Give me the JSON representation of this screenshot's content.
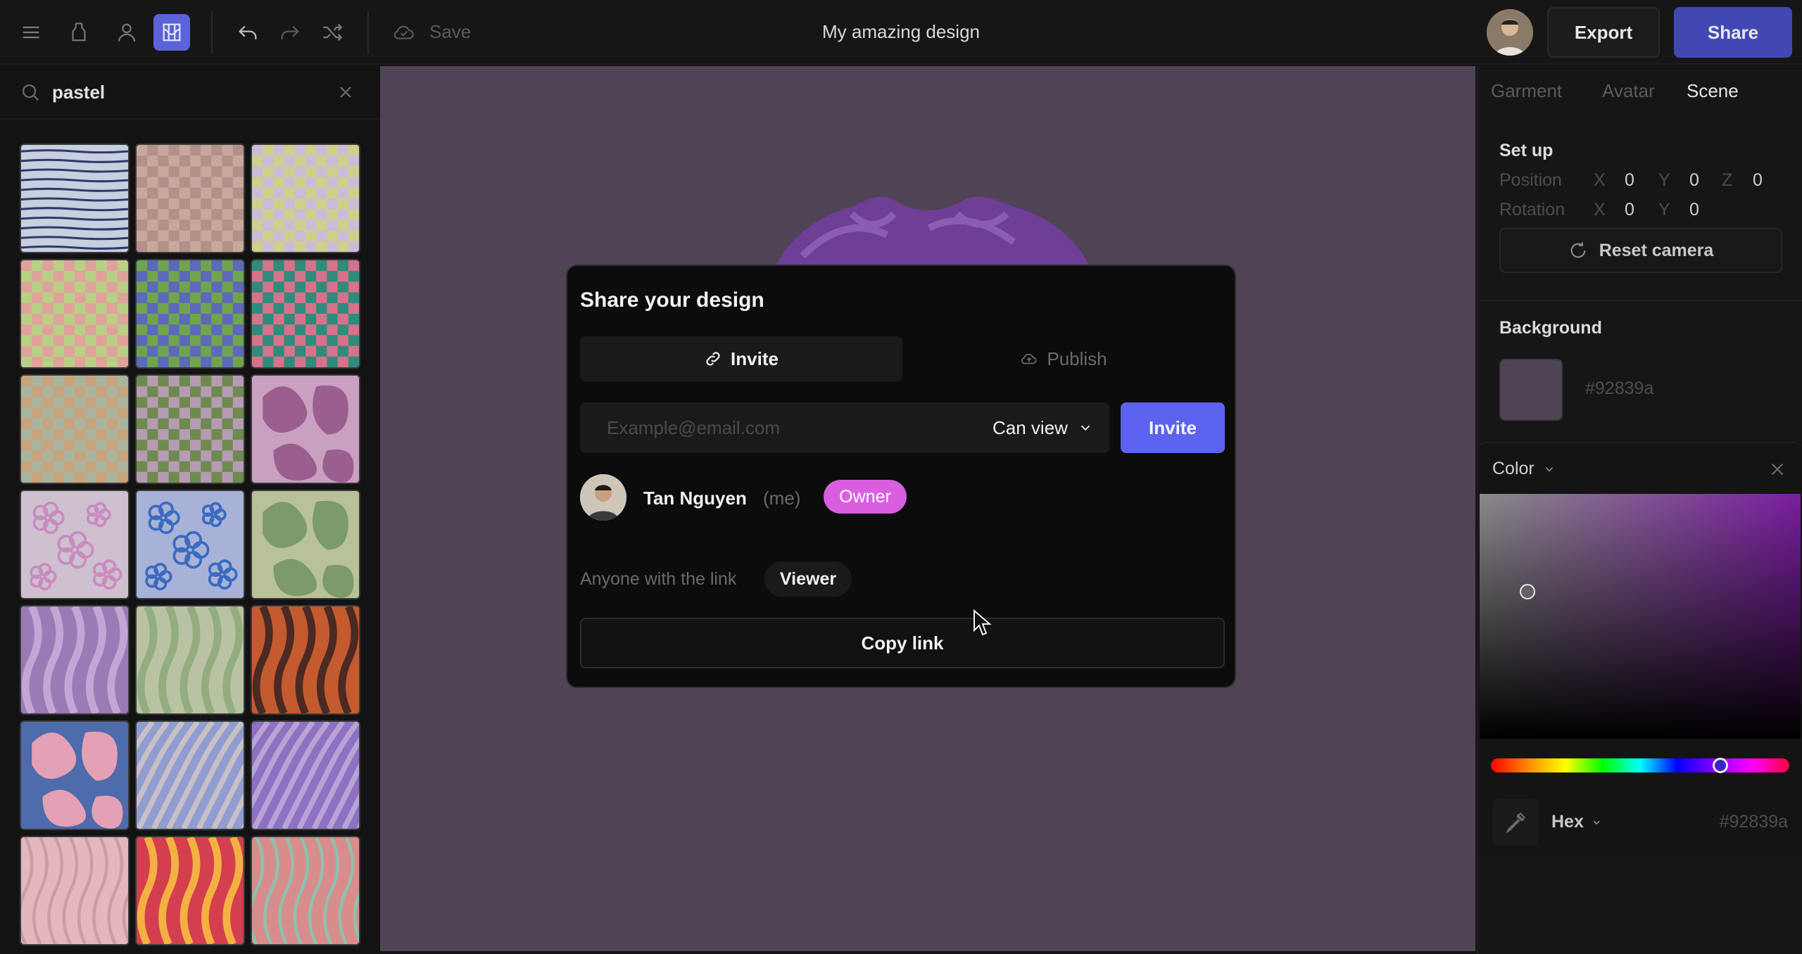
{
  "toolbar": {
    "save_label": "Save",
    "title": "My amazing design",
    "export_label": "Export",
    "share_label": "Share"
  },
  "search": {
    "value": "pastel"
  },
  "patterns": [
    {
      "name": "blue stripes",
      "colors": [
        "#c7cfe0",
        "#2e3a66"
      ]
    },
    {
      "name": "pink checker",
      "colors": [
        "#c9a89b",
        "#b4908a"
      ]
    },
    {
      "name": "lilac yellow checker",
      "colors": [
        "#cbbdd8",
        "#cfd08a"
      ]
    },
    {
      "name": "peach green checker",
      "colors": [
        "#e0a39a",
        "#b9cf86"
      ]
    },
    {
      "name": "blue green checker",
      "colors": [
        "#6fa44e",
        "#5c6ab9"
      ]
    },
    {
      "name": "teal pink checker",
      "colors": [
        "#2f8c7a",
        "#d6728b"
      ]
    },
    {
      "name": "tan checker",
      "colors": [
        "#c7a37e",
        "#a9b49e"
      ]
    },
    {
      "name": "olive checker",
      "colors": [
        "#6f8a4f",
        "#b59bb3"
      ]
    },
    {
      "name": "pink blobs",
      "colors": [
        "#caa0c1",
        "#9a5f8f"
      ]
    },
    {
      "name": "pink flowers",
      "colors": [
        "#cfc0cf",
        "#c98cc0"
      ]
    },
    {
      "name": "blue flowers",
      "colors": [
        "#a8b2d9",
        "#3b6bc0"
      ]
    },
    {
      "name": "green blobs",
      "colors": [
        "#b9c199",
        "#7c9a6a"
      ]
    },
    {
      "name": "purple swirls",
      "colors": [
        "#9b7bb6",
        "#c3a6d6"
      ]
    },
    {
      "name": "sage swirls",
      "colors": [
        "#b9c3a3",
        "#93ad80"
      ]
    },
    {
      "name": "brown swirls",
      "colors": [
        "#c45b2e",
        "#4a2a22"
      ]
    },
    {
      "name": "blue pink blobs",
      "colors": [
        "#4e6bab",
        "#e4a0b4"
      ]
    },
    {
      "name": "blue zebra",
      "colors": [
        "#8f9dd0",
        "#c8c0c6"
      ]
    },
    {
      "name": "purple zebra",
      "colors": [
        "#8e71c2",
        "#b6a4d6"
      ]
    },
    {
      "name": "pink waves",
      "colors": [
        "#e2b8bd",
        "#cf9aa8"
      ]
    },
    {
      "name": "rainbow swirls",
      "colors": [
        "#d33f4e",
        "#f5b042"
      ]
    },
    {
      "name": "coral waves",
      "colors": [
        "#d98c8c",
        "#8ec1ad"
      ]
    }
  ],
  "right_panel": {
    "tabs": [
      "Garment",
      "Avatar",
      "Scene"
    ],
    "active_tab": "Scene",
    "setup_heading": "Set up",
    "position_label": "Position",
    "rotation_label": "Rotation",
    "x_label": "X",
    "y_label": "Y",
    "z_label": "Z",
    "position": {
      "x": "0",
      "y": "0",
      "z": "0"
    },
    "rotation": {
      "x": "0",
      "y": "0"
    },
    "reset_camera": "Reset camera",
    "background_heading": "Background",
    "background_hex": "#92839a"
  },
  "color_picker": {
    "title": "Color",
    "mode": "Hex",
    "hex_value": "#92839a",
    "saturation": 0.15,
    "value": 0.6,
    "hue_position": 0.77
  },
  "modal": {
    "title": "Share your design",
    "tab_invite": "Invite",
    "tab_publish": "Publish",
    "email_placeholder": "Example@email.com",
    "permission": "Can view",
    "invite_button": "Invite",
    "user_name": "Tan Nguyen",
    "user_me": "(me)",
    "owner_badge": "Owner",
    "link_label": "Anyone with the link",
    "link_role": "Viewer",
    "copy_link": "Copy link"
  },
  "colors": {
    "accent": "#5b63f0",
    "share_button": "#4148b3",
    "owner_badge": "#d95fe0",
    "canvas_bg": "#4f4455"
  }
}
